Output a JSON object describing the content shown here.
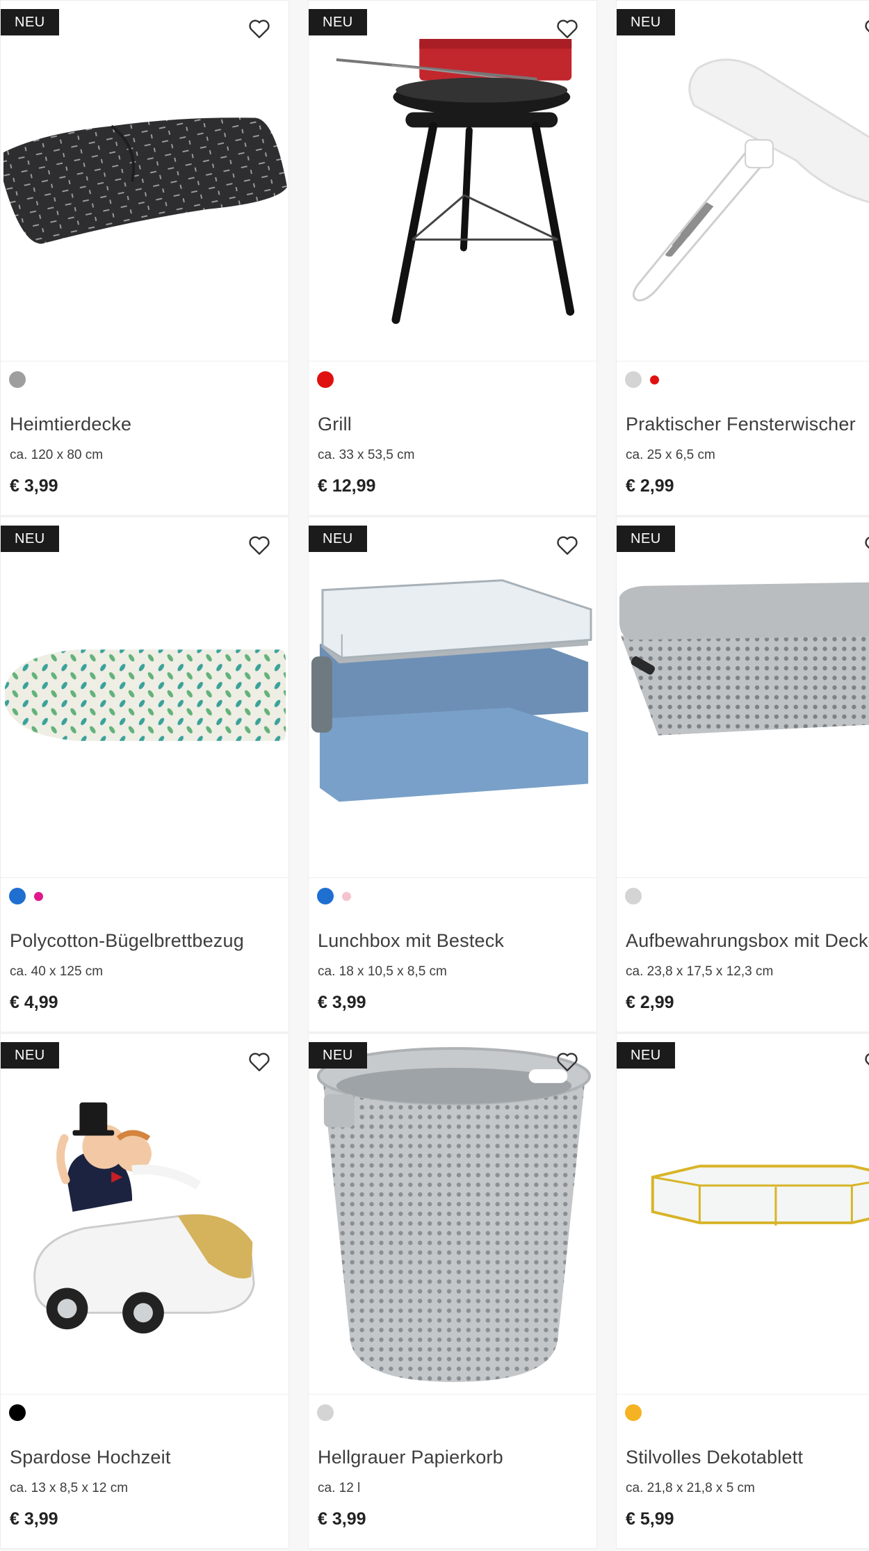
{
  "badge_label": "NEU",
  "products": [
    {
      "title": "Heimtierdecke",
      "size": "ca. 120 x 80 cm",
      "price": "€ 3,99",
      "image": "pet-blanket",
      "colors": [
        "#9e9e9e"
      ]
    },
    {
      "title": "Grill",
      "size": "ca. 33 x 53,5 cm",
      "price": "€ 12,99",
      "image": "charcoal-grill",
      "colors": [
        "#e01010"
      ]
    },
    {
      "title": "Praktischer Fensterwischer",
      "size": "ca. 25 x 6,5 cm",
      "price": "€ 2,99",
      "image": "window-wiper",
      "colors": [
        "#d4d4d4",
        "#e01010"
      ]
    },
    {
      "title": "Polycotton-Bügelbrettbezug",
      "size": "ca. 40 x 125 cm",
      "price": "€ 4,99",
      "image": "ironing-board-cover",
      "colors": [
        "#1f6fd1",
        "#e0188c"
      ]
    },
    {
      "title": "Lunchbox mit Besteck",
      "size": "ca. 18 x 10,5 x 8,5 cm",
      "price": "€ 3,99",
      "image": "lunchbox",
      "colors": [
        "#1f6fd1",
        "#f4c4cf"
      ]
    },
    {
      "title": "Aufbewahrungsbox mit Deckel",
      "size": "ca. 23,8 x 17,5 x 12,3 cm",
      "price": "€ 2,99",
      "image": "storage-box",
      "colors": [
        "#d4d4d4"
      ]
    },
    {
      "title": "Spardose Hochzeit",
      "size": "ca. 13 x 8,5 x 12 cm",
      "price": "€ 3,99",
      "image": "wedding-piggy-bank",
      "colors": [
        "#000000"
      ]
    },
    {
      "title": "Hellgrauer Papierkorb",
      "size": "ca. 12 l",
      "price": "€ 3,99",
      "image": "waste-basket",
      "colors": [
        "#d4d4d4"
      ]
    },
    {
      "title": "Stilvolles Dekotablett",
      "size": "ca. 21,8 x 21,8 x 5 cm",
      "price": "€ 5,99",
      "image": "deco-tray",
      "colors": [
        "#f5b324"
      ]
    }
  ]
}
